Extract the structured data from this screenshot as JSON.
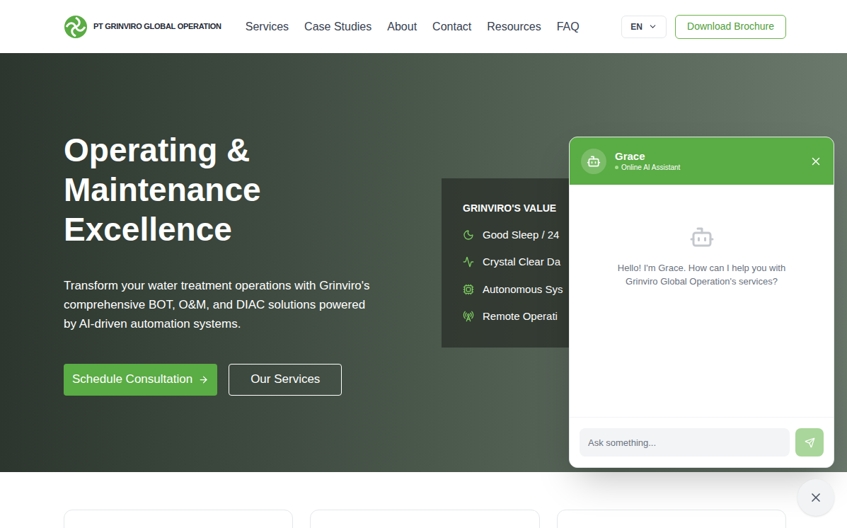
{
  "header": {
    "logo_text": "PT GRINVIRO GLOBAL OPERATION",
    "nav": [
      {
        "label": "Services"
      },
      {
        "label": "Case Studies"
      },
      {
        "label": "About"
      },
      {
        "label": "Contact"
      },
      {
        "label": "Resources"
      },
      {
        "label": "FAQ"
      }
    ],
    "language": "EN",
    "cta": "Download Brochure"
  },
  "hero": {
    "title": "Operating & Maintenance Excellence",
    "subtitle": "Transform your water treatment operations with Grinviro's comprehensive BOT, O&M, and DIAC solutions powered by AI-driven automation systems.",
    "buttons": [
      {
        "label": "Schedule Consultation",
        "kind": "primary"
      },
      {
        "label": "Our Services",
        "kind": "outline"
      }
    ]
  },
  "value_panel": {
    "title": "GRINVIRO'S VALUE",
    "items": [
      "Good Sleep / 24",
      "Crystal Clear Da",
      "Autonomous Sys",
      "Remote Operati"
    ]
  },
  "chat": {
    "name": "Grace",
    "status": "Online AI Assistant",
    "greeting": "Hello! I'm Grace. How can I help you with Grinviro Global Operation's services?",
    "placeholder": "Ask something..."
  }
}
